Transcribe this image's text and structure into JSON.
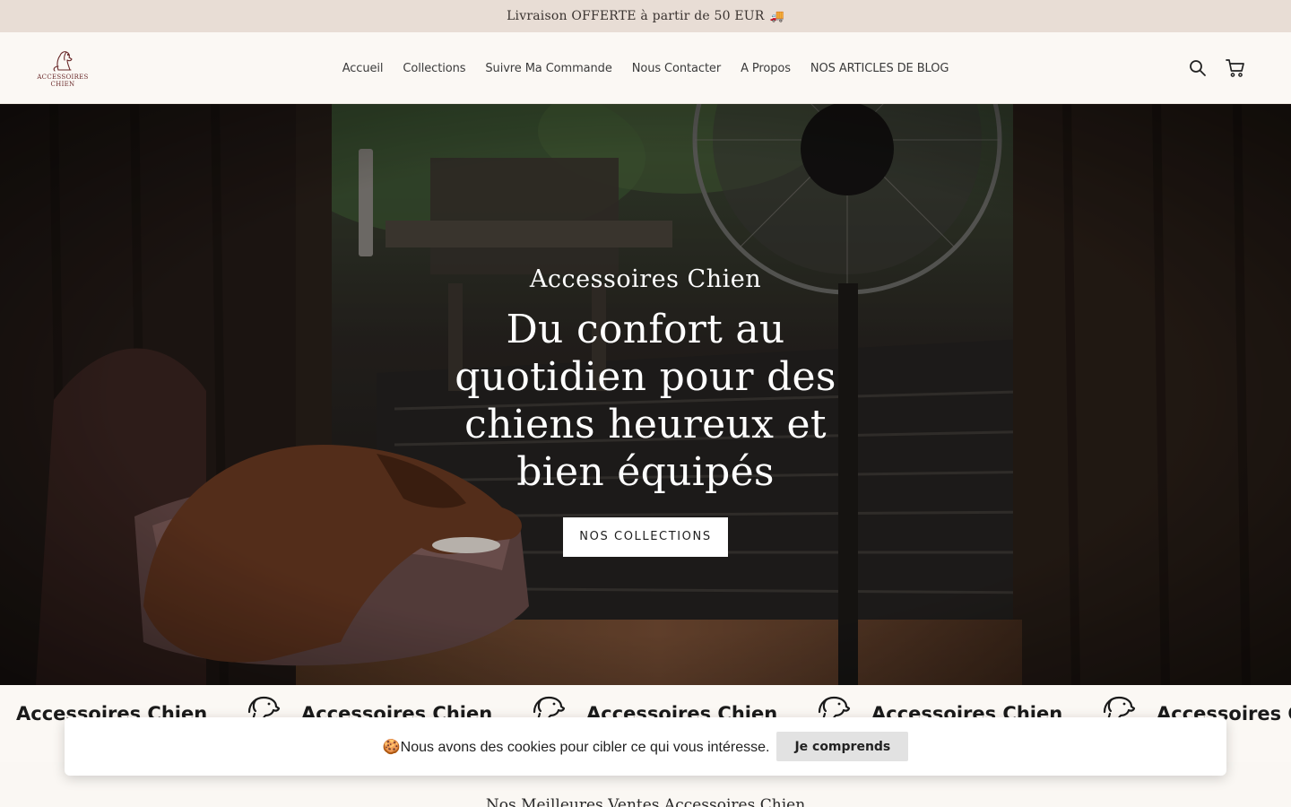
{
  "announcement": {
    "text": "Livraison OFFERTE à partir de 50 EUR",
    "emoji": "🚚"
  },
  "header": {
    "logo": {
      "line1": "ACCESSOIRES",
      "line2": "CHIEN"
    },
    "nav": [
      "Accueil",
      "Collections",
      "Suivre Ma Commande",
      "Nous Contacter",
      "A Propos",
      "NOS ARTICLES DE BLOG"
    ],
    "icons": [
      "search-icon",
      "cart-icon"
    ]
  },
  "hero": {
    "subtitle": "Accessoires Chien",
    "title": "Du confort au quotidien pour des chiens heureux et bien équipés",
    "button_label": "NOS COLLECTIONS"
  },
  "marquee": {
    "text": "Accessoires Chien",
    "icon": "dog-icon"
  },
  "cookie_banner": {
    "emoji": "🍪",
    "text": "Nous avons des cookies pour cibler ce qui vous intéresse.",
    "button_label": "Je comprends"
  },
  "best_sellers": {
    "title": "Nos Meilleures Ventes Accessoires Chien"
  },
  "colors": {
    "announcement_bg": "#e8ddd5",
    "header_bg": "#fbf8f4",
    "logo_accent": "#6a2a2a",
    "button_bg": "#ffffff",
    "cookie_button_bg": "#e2e2e2"
  }
}
